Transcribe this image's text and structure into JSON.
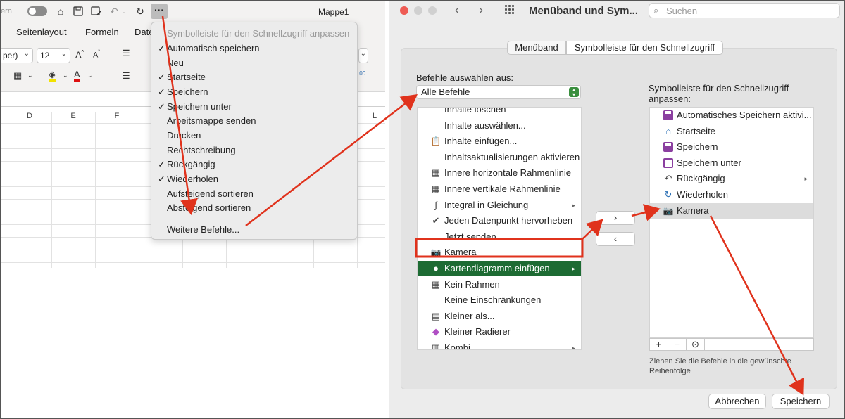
{
  "excel": {
    "title_left_truncated": "ern",
    "window_title": "Mappe1",
    "ribbon_tabs": [
      "Seitenlayout",
      "Formeln",
      "Date"
    ],
    "font_name_value": "per)",
    "font_size_value": "12",
    "column_headers": [
      "D",
      "E",
      "F",
      "L"
    ]
  },
  "qa_menu": {
    "items": [
      {
        "label": "Symbolleiste für den Schnellzugriff anpassen",
        "checked": false,
        "disabled": true
      },
      {
        "label": "Automatisch speichern",
        "checked": true,
        "disabled": false
      },
      {
        "label": "Neu",
        "checked": false,
        "disabled": false
      },
      {
        "label": "Startseite",
        "checked": true,
        "disabled": false
      },
      {
        "label": "Speichern",
        "checked": true,
        "disabled": false
      },
      {
        "label": "Speichern unter",
        "checked": true,
        "disabled": false
      },
      {
        "label": "Arbeitsmappe senden",
        "checked": false,
        "disabled": false
      },
      {
        "label": "Drucken",
        "checked": false,
        "disabled": false
      },
      {
        "label": "Rechtschreibung",
        "checked": false,
        "disabled": false
      },
      {
        "label": "Rückgängig",
        "checked": true,
        "disabled": false
      },
      {
        "label": "Wiederholen",
        "checked": true,
        "disabled": false
      },
      {
        "label": "Aufsteigend sortieren",
        "checked": false,
        "disabled": false
      },
      {
        "label": "Absteigend sortieren",
        "checked": false,
        "disabled": false
      }
    ],
    "more_commands": "Weitere Befehle..."
  },
  "dialog": {
    "title": "Menüband und Sym...",
    "search_placeholder": "Suchen",
    "tabs": {
      "ribbon": "Menüband",
      "qat": "Symbolleiste für den Schnellzugriff"
    },
    "choose_label": "Befehle auswählen aus:",
    "choose_value": "Alle Befehle",
    "commands": [
      {
        "label": "Inhalte löschen",
        "icon": "blank"
      },
      {
        "label": "Inhalte auswählen...",
        "icon": "blank"
      },
      {
        "label": "Inhalte einfügen...",
        "icon": "paste-icon"
      },
      {
        "label": "Inhaltsaktualisierungen aktivieren",
        "icon": "blank"
      },
      {
        "label": "Innere horizontale Rahmenlinie",
        "icon": "border-icon"
      },
      {
        "label": "Innere vertikale Rahmenlinie",
        "icon": "border-icon"
      },
      {
        "label": "Integral in Gleichung",
        "icon": "integral-icon",
        "submenu": true
      },
      {
        "label": "Jeden Datenpunkt hervorheben",
        "icon": "check-icon"
      },
      {
        "label": "Jetzt senden",
        "icon": "blank"
      },
      {
        "label": "Kamera",
        "icon": "camera-icon"
      },
      {
        "label": "Kartendiagramm einfügen",
        "icon": "map-chart-icon",
        "submenu": true,
        "selected": true
      },
      {
        "label": "Kein Rahmen",
        "icon": "border-icon"
      },
      {
        "label": "Keine Einschränkungen",
        "icon": "blank"
      },
      {
        "label": "Kleiner als...",
        "icon": "less-than-icon"
      },
      {
        "label": "Kleiner Radierer",
        "icon": "eraser-icon"
      },
      {
        "label": "Kombi",
        "icon": "combo-chart-icon",
        "submenu": true
      }
    ],
    "add_arrow": "›",
    "remove_arrow": "‹",
    "toolbar_label_line1": "Symbolleiste für den Schnellzugriff",
    "toolbar_label_line2": "anpassen:",
    "toolbar_items": [
      {
        "label": "Automatisches Speichern aktivi...",
        "icon": "autosave-icon"
      },
      {
        "label": "Startseite",
        "icon": "home-icon"
      },
      {
        "label": "Speichern",
        "icon": "save-icon"
      },
      {
        "label": "Speichern unter",
        "icon": "save-as-icon"
      },
      {
        "label": "Rückgängig",
        "icon": "undo-icon",
        "submenu": true
      },
      {
        "label": "Wiederholen",
        "icon": "redo-icon"
      },
      {
        "label": "Kamera",
        "icon": "camera-icon",
        "selected": true
      }
    ],
    "hint_line1": "Ziehen Sie die Befehle in die gewünschte",
    "hint_line2": "Reihenfolge",
    "cancel": "Abbrechen",
    "save": "Speichern"
  },
  "colors": {
    "highlight_box": "#e0321c",
    "annotation_arrow": "#e0321c",
    "selected_row": "#1d6b33"
  }
}
